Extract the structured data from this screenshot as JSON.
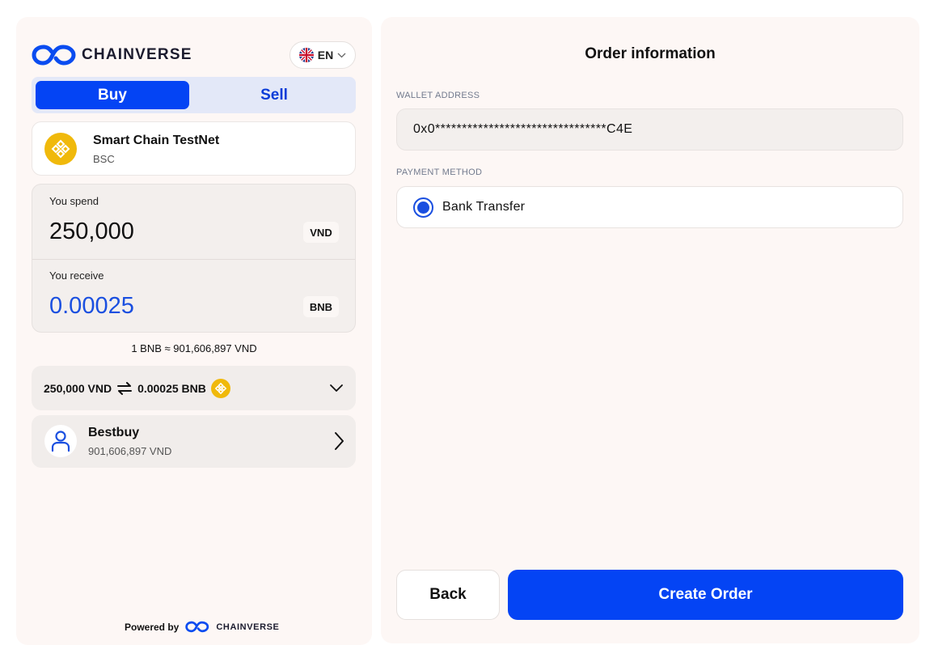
{
  "brand": {
    "name": "CHAINVERSE",
    "accent_color": "#0444f4",
    "logo_icon": "chainverse-logo-icon"
  },
  "language": {
    "code": "EN",
    "flag_icon": "uk-flag-icon"
  },
  "tabs": {
    "buy_label": "Buy",
    "sell_label": "Sell",
    "active": "Buy"
  },
  "network": {
    "name": "Smart Chain TestNet",
    "symbol": "BSC",
    "icon": "bnb-icon"
  },
  "spend": {
    "label": "You spend",
    "amount": "250,000",
    "currency": "VND"
  },
  "receive": {
    "label": "You receive",
    "amount": "0.00025",
    "currency": "BNB"
  },
  "rate_text": "1 BNB ≈ 901,606,897 VND",
  "summary": {
    "from": "250,000 VND",
    "to": "0.00025 BNB",
    "swap_icon": "swap-arrows-icon",
    "chevron_icon": "chevron-down-icon"
  },
  "provider": {
    "name": "Bestbuy",
    "price": "901,606,897 VND",
    "icon": "user-icon"
  },
  "footer": {
    "powered_by": "Powered by",
    "brand": "CHAINVERSE"
  },
  "order": {
    "title": "Order information",
    "wallet_label": "WALLET ADDRESS",
    "wallet_value": "0x0********************************C4E",
    "payment_label": "PAYMENT METHOD",
    "payment_option": "Bank Transfer",
    "payment_selected": true,
    "back_label": "Back",
    "create_label": "Create Order"
  }
}
